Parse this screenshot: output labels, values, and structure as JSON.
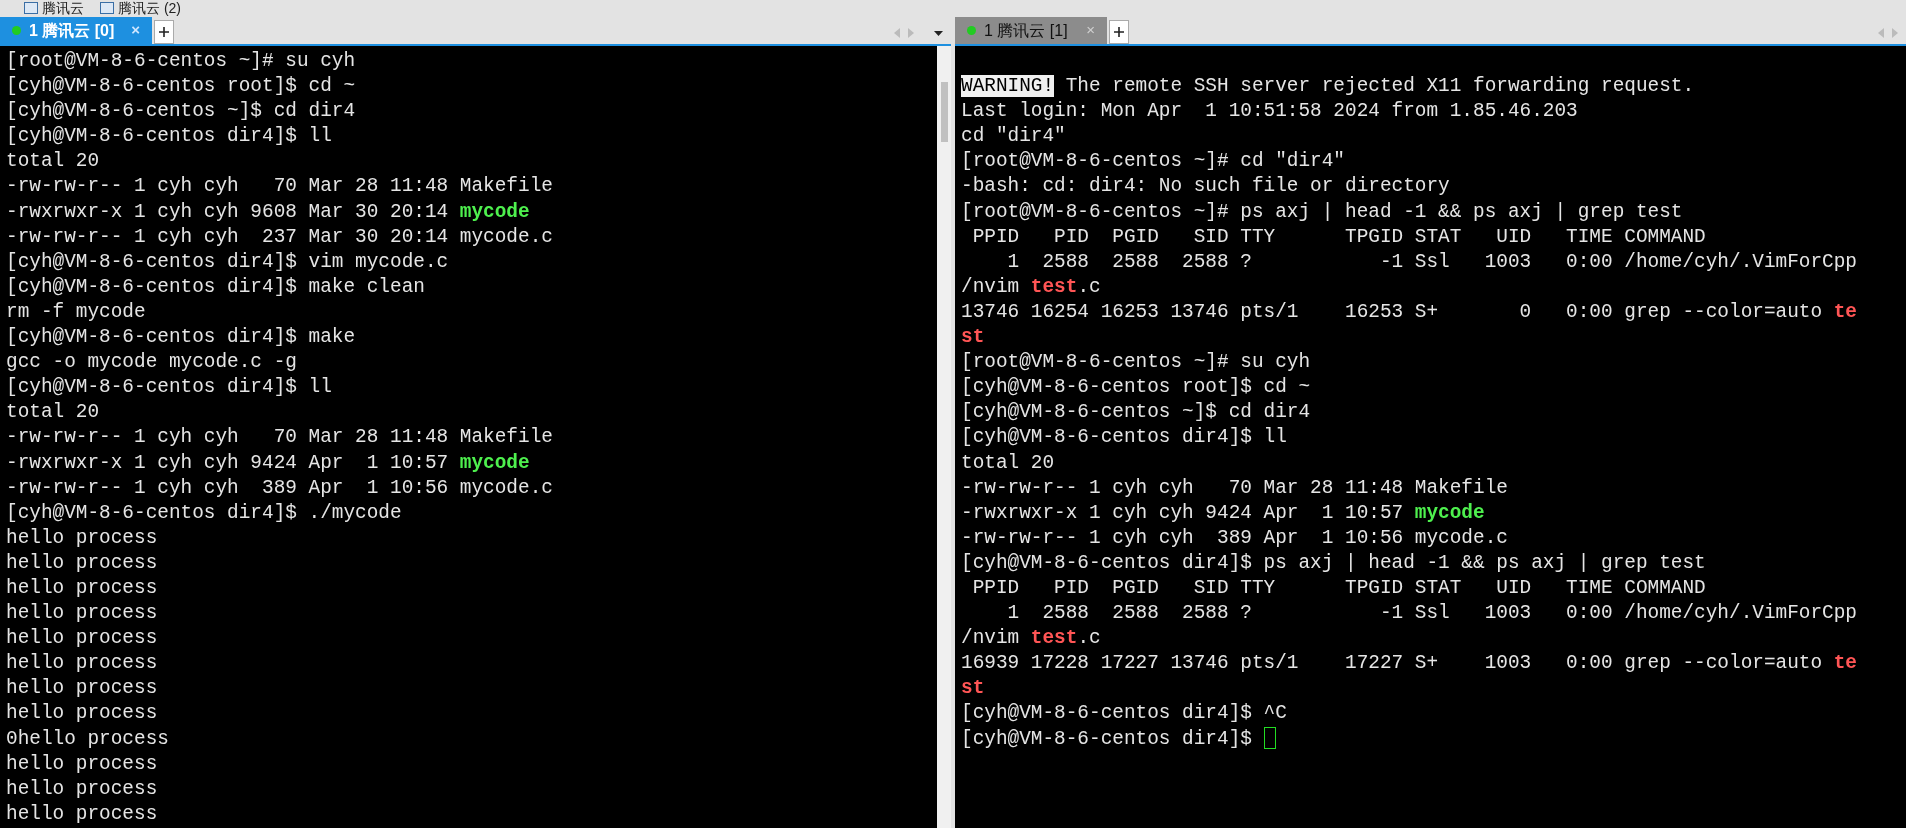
{
  "toolbar": {
    "items": [
      {
        "label": "腾讯云"
      },
      {
        "label": "腾讯云 (2)"
      }
    ]
  },
  "panes": [
    {
      "tab": {
        "label": "1 腾讯云 [0]",
        "selected": true,
        "close": "×"
      },
      "blank_first_line": false,
      "lines": [
        [
          {
            "text": "[root@VM-8-6-centos ~]# su cyh",
            "kind": "plain"
          }
        ],
        [
          {
            "text": "[cyh@VM-8-6-centos root]$ cd ~",
            "kind": "plain"
          }
        ],
        [
          {
            "text": "[cyh@VM-8-6-centos ~]$ cd dir4",
            "kind": "plain"
          }
        ],
        [
          {
            "text": "[cyh@VM-8-6-centos dir4]$ ll",
            "kind": "plain"
          }
        ],
        [
          {
            "text": "total 20",
            "kind": "plain"
          }
        ],
        [
          {
            "text": "-rw-rw-r-- 1 cyh cyh   70 Mar 28 11:48 Makefile",
            "kind": "plain"
          }
        ],
        [
          {
            "text": "-rwxrwxr-x 1 cyh cyh 9608 Mar 30 20:14 ",
            "kind": "plain"
          },
          {
            "text": "mycode",
            "kind": "exec"
          }
        ],
        [
          {
            "text": "-rw-rw-r-- 1 cyh cyh  237 Mar 30 20:14 mycode.c",
            "kind": "plain"
          }
        ],
        [
          {
            "text": "[cyh@VM-8-6-centos dir4]$ vim mycode.c",
            "kind": "plain"
          }
        ],
        [
          {
            "text": "[cyh@VM-8-6-centos dir4]$ make clean",
            "kind": "plain"
          }
        ],
        [
          {
            "text": "rm -f mycode",
            "kind": "plain"
          }
        ],
        [
          {
            "text": "[cyh@VM-8-6-centos dir4]$ make",
            "kind": "plain"
          }
        ],
        [
          {
            "text": "gcc -o mycode mycode.c -g",
            "kind": "plain"
          }
        ],
        [
          {
            "text": "[cyh@VM-8-6-centos dir4]$ ll",
            "kind": "plain"
          }
        ],
        [
          {
            "text": "total 20",
            "kind": "plain"
          }
        ],
        [
          {
            "text": "-rw-rw-r-- 1 cyh cyh   70 Mar 28 11:48 Makefile",
            "kind": "plain"
          }
        ],
        [
          {
            "text": "-rwxrwxr-x 1 cyh cyh 9424 Apr  1 10:57 ",
            "kind": "plain"
          },
          {
            "text": "mycode",
            "kind": "exec"
          }
        ],
        [
          {
            "text": "-rw-rw-r-- 1 cyh cyh  389 Apr  1 10:56 mycode.c",
            "kind": "plain"
          }
        ],
        [
          {
            "text": "[cyh@VM-8-6-centos dir4]$ ./mycode",
            "kind": "plain"
          }
        ],
        [
          {
            "text": "hello process",
            "kind": "plain"
          }
        ],
        [
          {
            "text": "hello process",
            "kind": "plain"
          }
        ],
        [
          {
            "text": "hello process",
            "kind": "plain"
          }
        ],
        [
          {
            "text": "hello process",
            "kind": "plain"
          }
        ],
        [
          {
            "text": "hello process",
            "kind": "plain"
          }
        ],
        [
          {
            "text": "hello process",
            "kind": "plain"
          }
        ],
        [
          {
            "text": "hello process",
            "kind": "plain"
          }
        ],
        [
          {
            "text": "hello process",
            "kind": "plain"
          }
        ],
        [
          {
            "text": "0hello process",
            "kind": "plain"
          }
        ],
        [
          {
            "text": "hello process",
            "kind": "plain"
          }
        ],
        [
          {
            "text": "hello process",
            "kind": "plain"
          }
        ],
        [
          {
            "text": "hello process",
            "kind": "plain"
          }
        ]
      ],
      "cursor": false,
      "scrollbar": true
    },
    {
      "tab": {
        "label": "1 腾讯云 [1]",
        "selected": false,
        "close": "×"
      },
      "blank_first_line": true,
      "lines": [
        [
          {
            "text": "WARNING!",
            "kind": "inverse"
          },
          {
            "text": " The remote SSH server rejected X11 forwarding request.",
            "kind": "plain"
          }
        ],
        [
          {
            "text": "Last login: Mon Apr  1 10:51:58 2024 from 1.85.46.203",
            "kind": "plain"
          }
        ],
        [
          {
            "text": "cd \"dir4\"",
            "kind": "plain"
          }
        ],
        [
          {
            "text": "[root@VM-8-6-centos ~]# cd \"dir4\"",
            "kind": "plain"
          }
        ],
        [
          {
            "text": "-bash: cd: dir4: No such file or directory",
            "kind": "plain"
          }
        ],
        [
          {
            "text": "[root@VM-8-6-centos ~]# ps axj | head -1 && ps axj | grep test",
            "kind": "plain"
          }
        ],
        [
          {
            "text": " PPID   PID  PGID   SID TTY      TPGID STAT   UID   TIME COMMAND",
            "kind": "plain"
          }
        ],
        [
          {
            "text": "    1  2588  2588  2588 ?           -1 Ssl   1003   0:00 /home/cyh/.VimForCpp",
            "kind": "plain"
          }
        ],
        [
          {
            "text": "/nvim ",
            "kind": "plain"
          },
          {
            "text": "test",
            "kind": "match"
          },
          {
            "text": ".c",
            "kind": "plain"
          }
        ],
        [
          {
            "text": "13746 16254 16253 13746 pts/1    16253 S+       0   0:00 grep --color=auto ",
            "kind": "plain"
          },
          {
            "text": "te",
            "kind": "match"
          }
        ],
        [
          {
            "text": "st",
            "kind": "match"
          }
        ],
        [
          {
            "text": "[root@VM-8-6-centos ~]# su cyh",
            "kind": "plain"
          }
        ],
        [
          {
            "text": "[cyh@VM-8-6-centos root]$ cd ~",
            "kind": "plain"
          }
        ],
        [
          {
            "text": "[cyh@VM-8-6-centos ~]$ cd dir4",
            "kind": "plain"
          }
        ],
        [
          {
            "text": "[cyh@VM-8-6-centos dir4]$ ll",
            "kind": "plain"
          }
        ],
        [
          {
            "text": "total 20",
            "kind": "plain"
          }
        ],
        [
          {
            "text": "-rw-rw-r-- 1 cyh cyh   70 Mar 28 11:48 Makefile",
            "kind": "plain"
          }
        ],
        [
          {
            "text": "-rwxrwxr-x 1 cyh cyh 9424 Apr  1 10:57 ",
            "kind": "plain"
          },
          {
            "text": "mycode",
            "kind": "exec"
          }
        ],
        [
          {
            "text": "-rw-rw-r-- 1 cyh cyh  389 Apr  1 10:56 mycode.c",
            "kind": "plain"
          }
        ],
        [
          {
            "text": "[cyh@VM-8-6-centos dir4]$ ps axj | head -1 && ps axj | grep test",
            "kind": "plain"
          }
        ],
        [
          {
            "text": " PPID   PID  PGID   SID TTY      TPGID STAT   UID   TIME COMMAND",
            "kind": "plain"
          }
        ],
        [
          {
            "text": "    1  2588  2588  2588 ?           -1 Ssl   1003   0:00 /home/cyh/.VimForCpp",
            "kind": "plain"
          }
        ],
        [
          {
            "text": "/nvim ",
            "kind": "plain"
          },
          {
            "text": "test",
            "kind": "match"
          },
          {
            "text": ".c",
            "kind": "plain"
          }
        ],
        [
          {
            "text": "16939 17228 17227 13746 pts/1    17227 S+    1003   0:00 grep --color=auto ",
            "kind": "plain"
          },
          {
            "text": "te",
            "kind": "match"
          }
        ],
        [
          {
            "text": "st",
            "kind": "match"
          }
        ],
        [
          {
            "text": "[cyh@VM-8-6-centos dir4]$ ^C",
            "kind": "plain"
          }
        ],
        [
          {
            "text": "[cyh@VM-8-6-centos dir4]$ ",
            "kind": "plain"
          }
        ]
      ],
      "cursor": true,
      "scrollbar": false
    }
  ]
}
